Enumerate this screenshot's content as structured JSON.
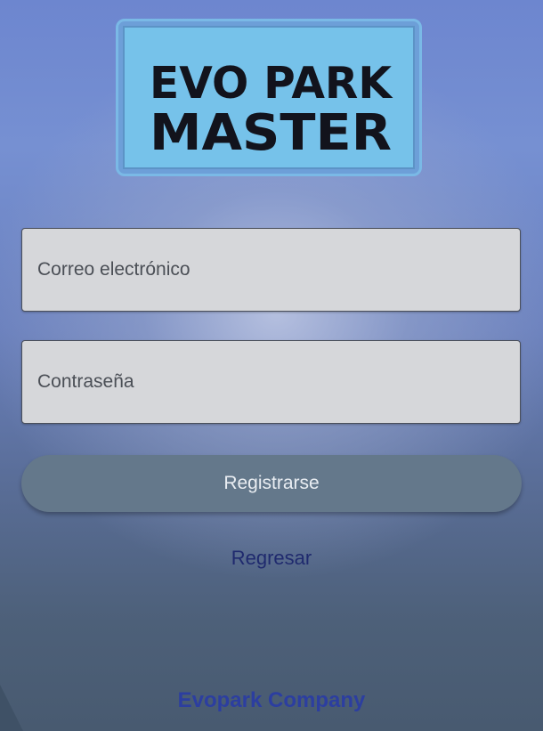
{
  "logo": {
    "line1": "EVO PARK",
    "line2": "MASTER",
    "text_color": "#12131c",
    "background_color": "#76c2ea",
    "frame_color": "#7ab9e6"
  },
  "form": {
    "email_placeholder": "Correo electrónico",
    "password_placeholder": "Contraseña",
    "submit_label": "Registrarse",
    "back_label": "Regresar"
  },
  "footer": {
    "company": "Evopark Company"
  },
  "colors": {
    "button": "#64788b",
    "link": "#1f2a6e",
    "footer_text": "#2c3ea0",
    "field_background": "#d6d7da"
  }
}
